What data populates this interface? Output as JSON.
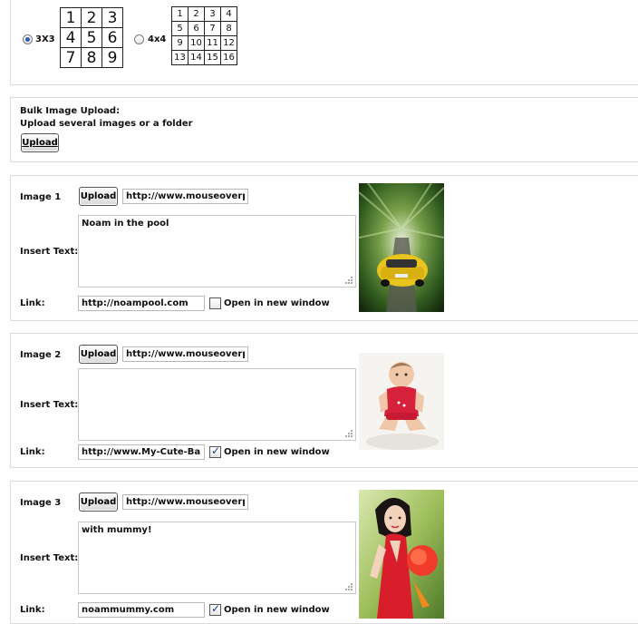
{
  "grid_options": {
    "option_3x3": {
      "label": "3X3",
      "selected": true,
      "cells": [
        "1",
        "2",
        "3",
        "4",
        "5",
        "6",
        "7",
        "8",
        "9"
      ]
    },
    "option_4x4": {
      "label": "4x4",
      "selected": false,
      "cells": [
        "1",
        "2",
        "3",
        "4",
        "5",
        "6",
        "7",
        "8",
        "9",
        "10",
        "11",
        "12",
        "13",
        "14",
        "15",
        "16"
      ]
    }
  },
  "bulk_upload": {
    "title": "Bulk Image Upload:",
    "description": "Upload several images or a folder",
    "button_label": "Upload"
  },
  "image_entries": [
    {
      "label": "Image 1",
      "upload_label": "Upload",
      "url": "http://www.mouseoverpl",
      "insert_text_label": "Insert Text:",
      "text": "Noam in the pool",
      "link_label": "Link:",
      "link": "http://noampool.com",
      "new_window_label": "Open in new window",
      "new_window_checked": false
    },
    {
      "label": "Image 2",
      "upload_label": "Upload",
      "url": "http://www.mouseoverpl",
      "insert_text_label": "Insert Text:",
      "text": "",
      "link_label": "Link:",
      "link": "http://www.My-Cute-Bab",
      "new_window_label": "Open in new window",
      "new_window_checked": true
    },
    {
      "label": "Image 3",
      "upload_label": "Upload",
      "url": "http://www.mouseoverpl",
      "insert_text_label": "Insert Text:",
      "text": "with mummy!",
      "link_label": "Link:",
      "link": "noammummy.com",
      "new_window_label": "Open in new window",
      "new_window_checked": true
    }
  ]
}
